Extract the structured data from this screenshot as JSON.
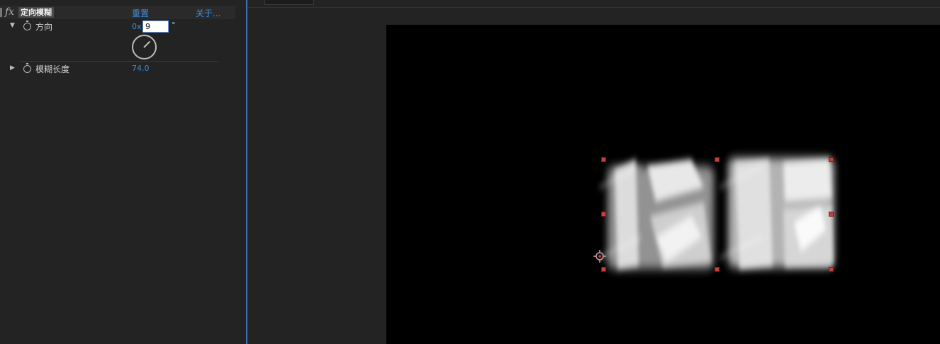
{
  "effect_panel": {
    "effect": {
      "fx_icon": "fx",
      "name": "定向模糊",
      "reset_label": "重置",
      "about_label": "关于..."
    },
    "properties": [
      {
        "label": "方向",
        "value_prefix": "0x",
        "input_value": "9",
        "unit": "°",
        "expanded": true
      },
      {
        "label": "模糊长度",
        "value": "74.0",
        "expanded": false
      }
    ]
  },
  "comp_viewer": {
    "layer_image": "blurred-text-模糊",
    "colors": {
      "accent": "#3d8fe0",
      "handle": "#c9403a",
      "canvas": "#000000",
      "panel": "#232323"
    }
  }
}
